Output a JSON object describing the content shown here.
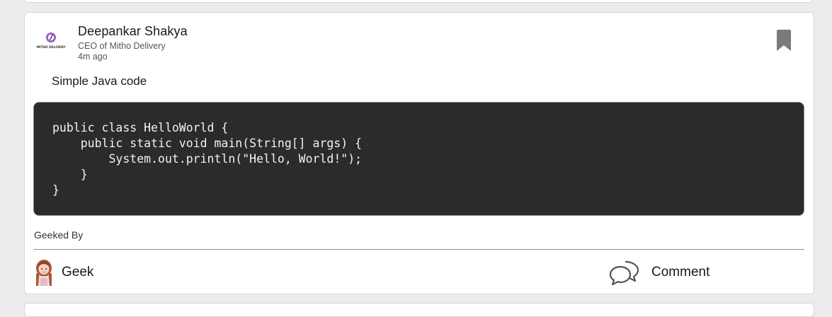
{
  "post": {
    "author": {
      "name": "Deepankar Shakya",
      "role": "CEO of Mitho Delivery",
      "time": "4m ago",
      "avatar_logo_text": "MITHO DELIVERY"
    },
    "text": "Simple Java code",
    "code": "public class HelloWorld {\n    public static void main(String[] args) {\n        System.out.println(\"Hello, World!\");\n    }\n}",
    "geeked_by_label": "Geeked By",
    "actions": {
      "geek_label": "Geek",
      "comment_label": "Comment"
    },
    "icons": {
      "bookmark": "bookmark-icon",
      "comment": "comment-bubbles-icon",
      "geek": "geek-avatar-icon"
    },
    "colors": {
      "code_background": "#2b2b2b",
      "code_text": "#f2f2f2",
      "bookmark": "#7a7a7a",
      "page_background": "#ececec",
      "logo_accent": "#9b59d0"
    }
  }
}
